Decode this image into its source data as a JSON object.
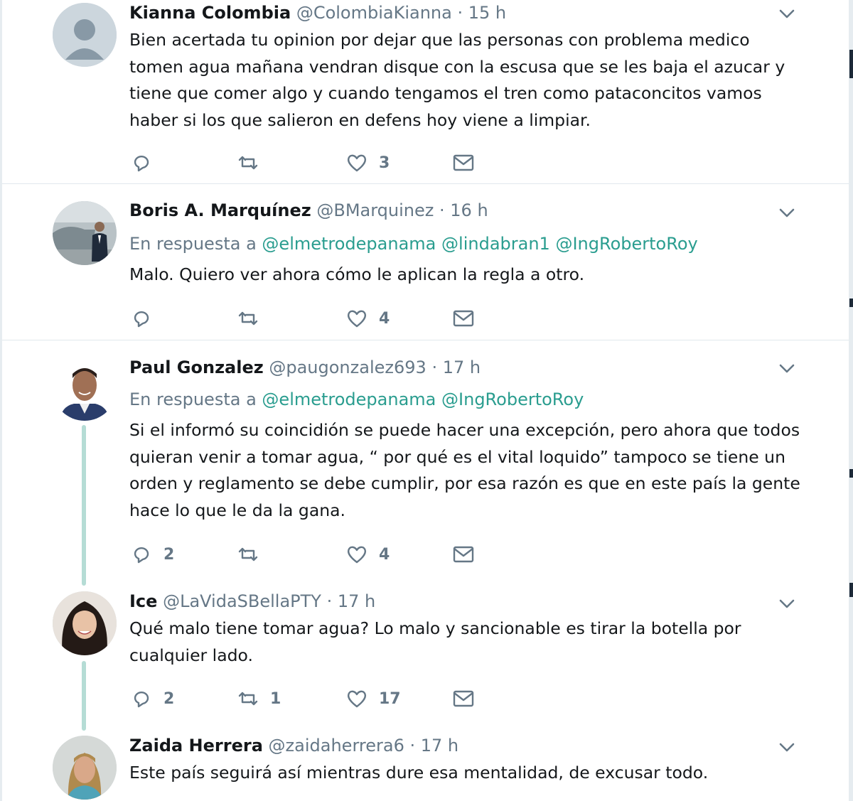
{
  "tweets": [
    {
      "name": "Kianna Colombia",
      "handle": "@ColombiaKianna",
      "time": "· 15 h",
      "reply_prefix": "",
      "mentions": [],
      "text": "Bien acertada tu opinion por dejar que las personas con problema medico tomen agua mañana vendran disque con la escusa que se les baja el azucar y tiene que comer algo y cuando tengamos el tren como pataconcitos vamos haber si los que salieron en defens hoy viene a limpiar.",
      "replies": "",
      "retweets": "",
      "likes": "3"
    },
    {
      "name": "Boris A. Marquínez",
      "handle": "@BMarquinez",
      "time": "· 16 h",
      "reply_prefix": "En respuesta a",
      "mentions": [
        "@elmetrodepanama",
        "@lindabran1",
        "@IngRobertoRoy"
      ],
      "text": "Malo. Quiero ver ahora cómo le aplican la regla a otro.",
      "replies": "",
      "retweets": "",
      "likes": "4"
    },
    {
      "name": "Paul Gonzalez",
      "handle": "@paugonzalez693",
      "time": "· 17 h",
      "reply_prefix": "En respuesta a",
      "mentions": [
        "@elmetrodepanama",
        "@IngRobertoRoy"
      ],
      "text": "Si el informó su coincidión se puede hacer una excepción, pero ahora que todos quieran venir a tomar agua, “ por qué es el vital loquido” tampoco se tiene un orden y reglamento se debe cumplir, por esa razón es que en este país la gente hace lo que le da la gana.",
      "replies": "2",
      "retweets": "",
      "likes": "4"
    },
    {
      "name": "Ice",
      "handle": "@LaVidaSBellaPTY",
      "time": "· 17 h",
      "reply_prefix": "",
      "mentions": [],
      "text": "Qué malo tiene tomar agua? Lo malo y sancionable es tirar la botella por cualquier lado.",
      "replies": "2",
      "retweets": "1",
      "likes": "17"
    },
    {
      "name": "Zaida Herrera",
      "handle": "@zaidaherrera6",
      "time": "· 17 h",
      "reply_prefix": "",
      "mentions": [],
      "text": "Este país seguirá así mientras dure esa mentalidad, de excusar todo.",
      "replies": "",
      "retweets": "",
      "likes": ""
    }
  ],
  "colors": {
    "mention": "#2aa39a",
    "thread_line": "#b5dcd5",
    "secondary_text": "#657786"
  },
  "icons": [
    "reply-icon",
    "retweet-icon",
    "like-icon",
    "direct-message-icon",
    "chevron-down-icon"
  ]
}
